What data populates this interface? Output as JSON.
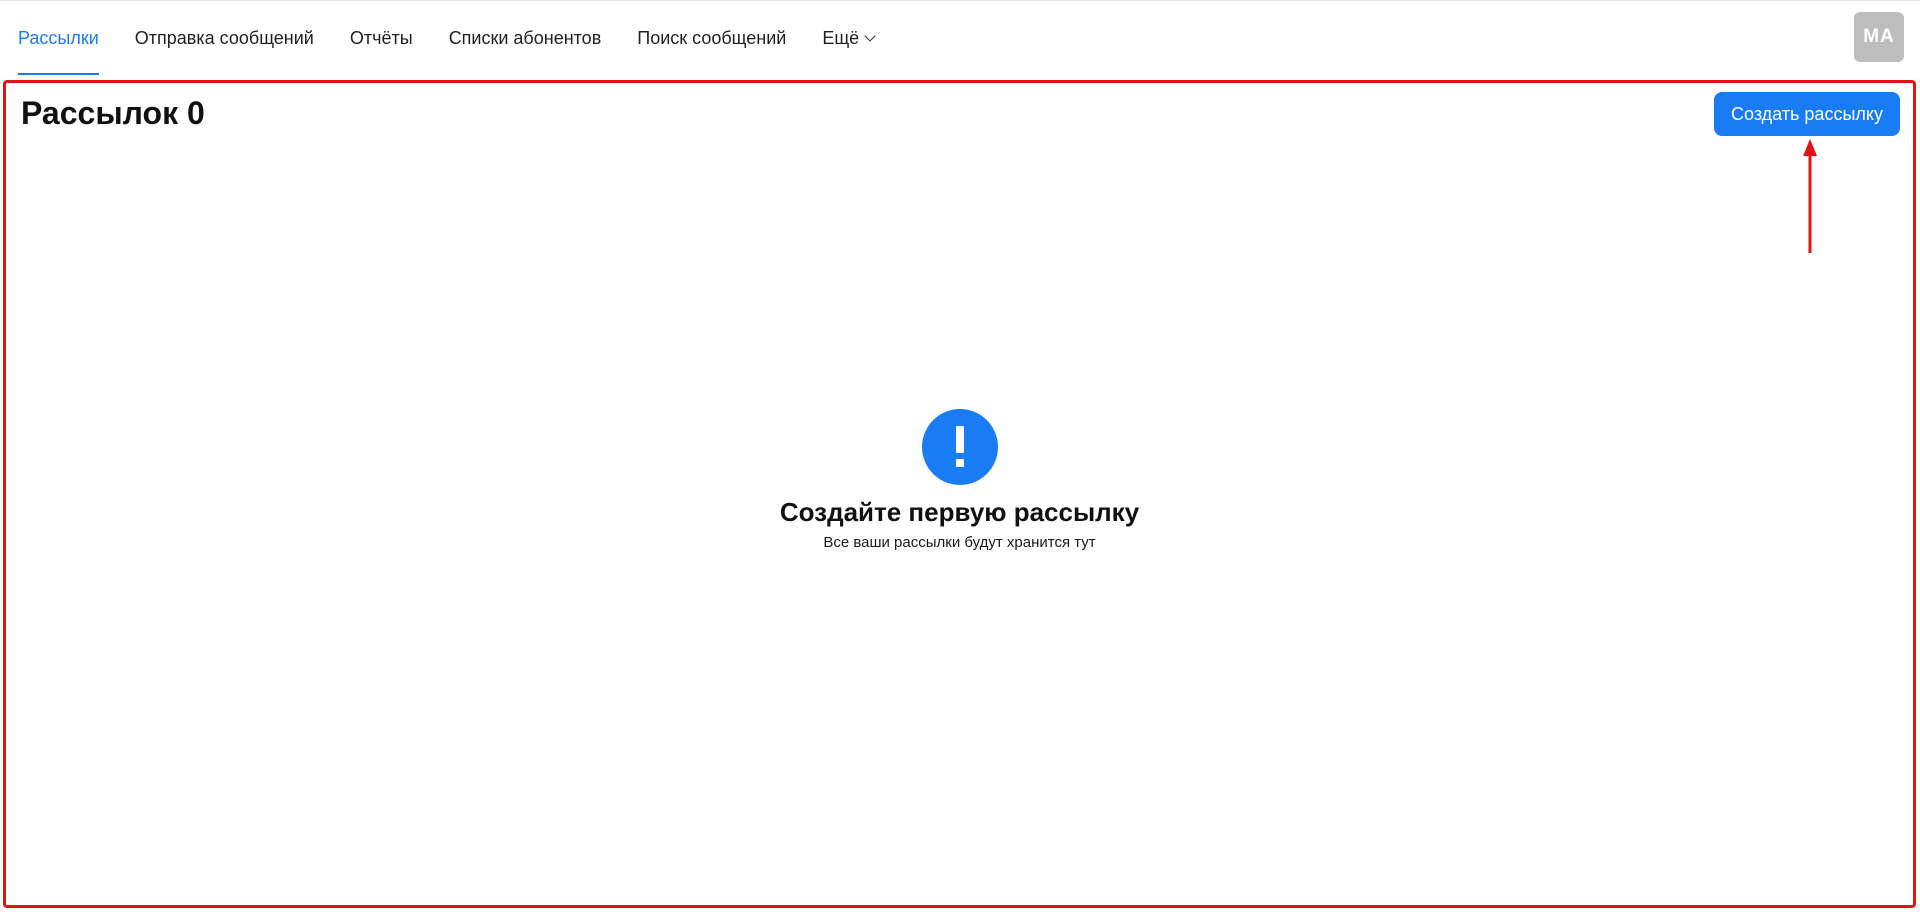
{
  "nav": {
    "items": [
      {
        "label": "Рассылки",
        "active": true
      },
      {
        "label": "Отправка сообщений",
        "active": false
      },
      {
        "label": "Отчёты",
        "active": false
      },
      {
        "label": "Списки абонентов",
        "active": false
      },
      {
        "label": "Поиск сообщений",
        "active": false
      }
    ],
    "more_label": "Ещё",
    "more_icon": "chevron-down-icon"
  },
  "user": {
    "initials": "MA"
  },
  "page": {
    "title": "Рассылок 0",
    "create_button_label": "Создать рассылку"
  },
  "empty_state": {
    "icon": "exclamation-icon",
    "title": "Создайте первую рассылку",
    "subtitle": "Все ваши рассылки будут хранится тут"
  },
  "colors": {
    "accent": "#1a7cf5",
    "highlight_frame": "#e01414",
    "avatar_bg": "#bdbdbd"
  }
}
